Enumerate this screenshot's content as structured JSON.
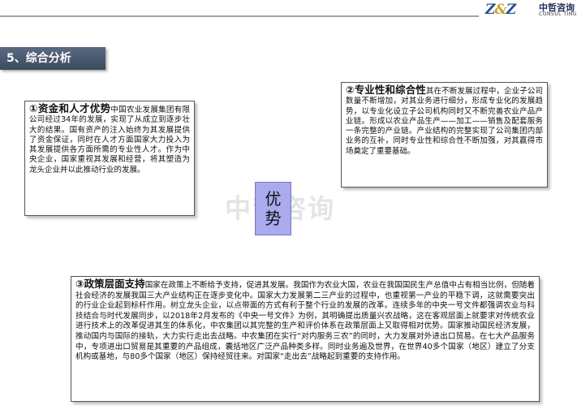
{
  "logo": {
    "mark_left": "Z",
    "mark_amp": "&",
    "mark_right": "Z",
    "cn": "中哲咨询",
    "en": "CONSUL TING"
  },
  "section": {
    "title": "5、综合分析"
  },
  "watermark": "中哲咨询",
  "center_badge": {
    "line1": "优",
    "line2": "势"
  },
  "box1": {
    "heading": "①资金和人才优势",
    "body": "中国农业发展集团有限公司经过34年的发展，实现了从成立到逐步壮大的结果。国有资产的注入始终为其发展提供了资金保证，同时在人才方面国家大力投入为其发展提供各方面所需的专业性人才。作为中央企业，国家重视其发展和经营，将其塑造为龙头企业并以此推动行业的发展。"
  },
  "box2": {
    "heading": "②专业性和综合性",
    "body": "其在不断发展过程中，企业子公司数量不断增加，对其业务进行细分，形成专业化的发展趋势，以专业化设立子公司机构同时又不断完善农业产品产业链。形成以农业产品生产——加工——销售及配套服务一条完整的产业链。产业结构的完整实现了公司集团内部业务的互补，同时专业性和综合性不断加强，对其赢得市场奠定了重要基础。"
  },
  "box3": {
    "heading": "③政策层面支持",
    "body": "国家在政策上不断给予支持，促进其发展。我国作为农业大国，农业在我国国民生产总值中占有相当比例，但随着社会经济的发展我国三大产业结构正在逐步变化中。国家大力发展第二三产业的过程中，也重视第一产业的平稳下调，这就需要突出的行业企业起到标杆作用。树立龙头企业，以点带面的方式有利于整个行业的发展的改革。连续多年的中央一号文件都强调农业与科技结合与时代发展同步，以2018年2月发布的《中央一号文件》为例，其明确提出质量兴农战略，这在客观层面上就要求对传统农业进行技术上的改革促进其生的体系化，中农集团以其完整的生产和评价体系在政策层面上又取得相对优势。国家推动国民经济发展，推动国内与国际的接轨，大力实行走出去战略。中农集团在实行“对内服务三农”的同时，大力发展对外进出口贸易。在七大产品服务中，专项进出口贸易是其重要的产品组成，囊括地区广泛产品种类多样。同时业务遍及世界，在世界40多个国家（地区）建立了分支机构或基地，与80多个国家（地区）保持经贸往来。对国家“走出去”战略起到重要的支持作用。"
  }
}
